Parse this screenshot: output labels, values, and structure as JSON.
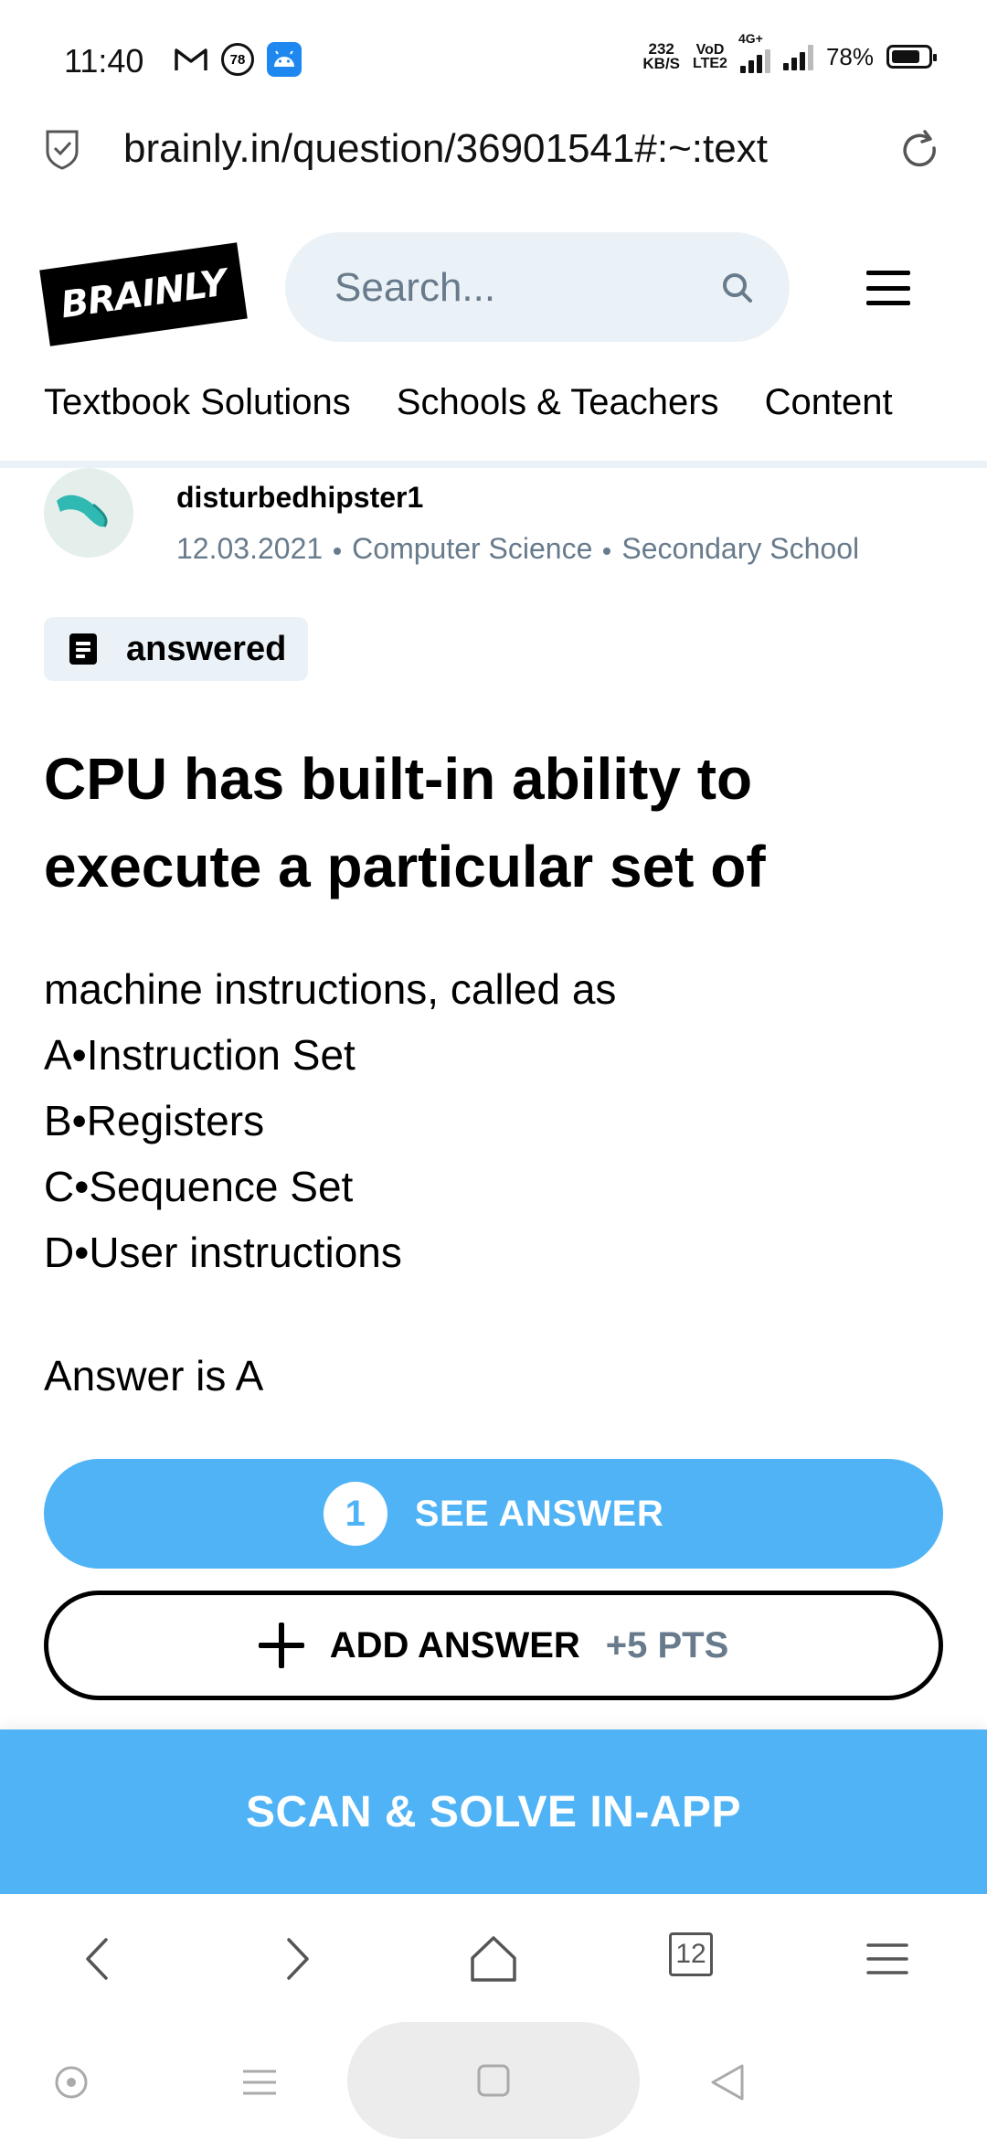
{
  "status_bar": {
    "time": "11:40",
    "notification_badge": "78",
    "net_speed_value": "232",
    "net_speed_unit": "KB/S",
    "volte_top": "VoD",
    "volte_bottom": "LTE2",
    "network_type": "4G+",
    "battery_percent": "78%",
    "battery_level": 0.78
  },
  "url_bar": {
    "url": "brainly.in/question/36901541#:~:text"
  },
  "header": {
    "logo_text": "BRAINLY",
    "search_placeholder": "Search..."
  },
  "nav_tabs": [
    {
      "label": "Textbook Solutions"
    },
    {
      "label": "Schools & Teachers"
    },
    {
      "label": "Content"
    }
  ],
  "question": {
    "author": "disturbedhipster1",
    "date": "12.03.2021",
    "subject": "Computer Science",
    "level": "Secondary School",
    "status_label": "answered",
    "title": "CPU has built-in ability to execute a particular set of",
    "body_lines": [
      "machine instructions, called as",
      "A•Instruction Set",
      "B•Registers",
      "C•Sequence Set",
      "D•User instructions"
    ],
    "answer_hint": "Answer is A"
  },
  "actions": {
    "see_answer_count": "1",
    "see_answer_label": "SEE ANSWER",
    "add_answer_label": "ADD ANSWER",
    "add_answer_points": "+5 PTS"
  },
  "banner": {
    "label": "SCAN & SOLVE IN-APP"
  },
  "browser_bar": {
    "tab_count": "12"
  },
  "colors": {
    "accent_blue": "#4fb3f6",
    "muted_text": "#687b8c",
    "light_bg": "#ebf2f7"
  }
}
